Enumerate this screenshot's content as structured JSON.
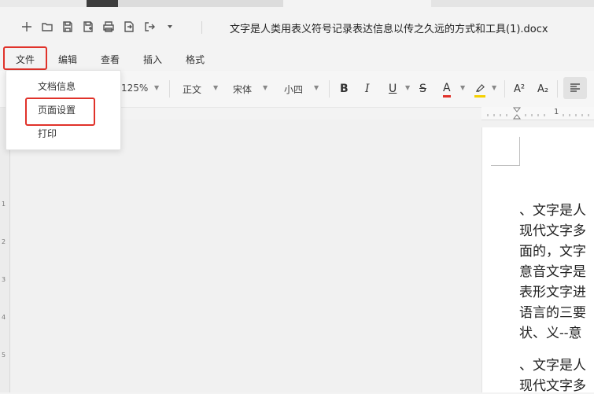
{
  "title_bar": {
    "document_title": "文字是人类用表义符号记录表达信息以传之久远的方式和工具(1).docx",
    "quick_access_icons": [
      "plus-icon",
      "folder-icon",
      "save-icon",
      "save-as-icon",
      "print-icon",
      "export-icon",
      "share-icon",
      "more-dropdown-icon"
    ]
  },
  "menu": {
    "items": [
      "文件",
      "编辑",
      "查看",
      "插入",
      "格式"
    ],
    "active": "文件"
  },
  "file_menu": {
    "items": [
      "文档信息",
      "页面设置",
      "打印"
    ],
    "highlighted": "页面设置"
  },
  "toolbar": {
    "zoom": "125%",
    "style": "正文",
    "font": "宋体",
    "size": "小四",
    "bold": "B",
    "italic": "I",
    "underline": "U",
    "strikethrough": "S",
    "font_color": "A",
    "superscript": "A²",
    "subscript": "A₂"
  },
  "ruler": {
    "top_number": "1",
    "left_numbers": [
      "1",
      "2",
      "3",
      "4",
      "5"
    ]
  },
  "document": {
    "lines": [
      "、文字是人",
      "现代文字多",
      "面的，文字",
      "意音文字是",
      "表形文字进",
      "语言的三要",
      "状、义--意",
      "、文字是人",
      "现代文字多"
    ]
  },
  "colors": {
    "highlight_border": "#e0322a",
    "font_color_bar": "#e0322a",
    "highlight_color_bar": "#f5d000"
  }
}
